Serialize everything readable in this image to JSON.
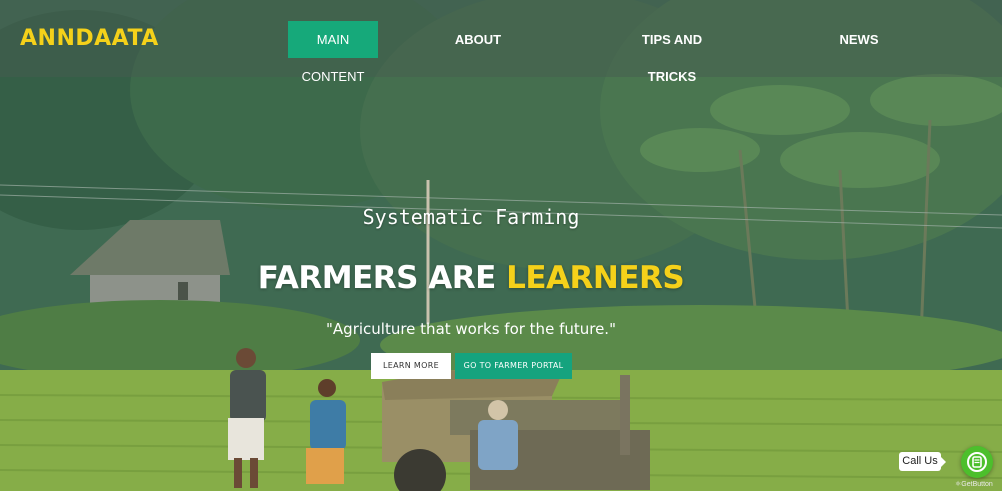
{
  "brand": {
    "name": "ANNDAATA"
  },
  "nav": {
    "items": [
      {
        "label": "MAIN CONTENT",
        "active": true
      },
      {
        "label": "ABOUT",
        "active": false
      },
      {
        "label": "TIPS AND TRICKS",
        "active": false
      },
      {
        "label": "NEWS",
        "active": false
      }
    ]
  },
  "hero": {
    "subtitle": "Systematic Farming",
    "headline_part1": "FARMERS ARE",
    "headline_part2": "LEARNERS",
    "quote": "\"Agriculture that works for the future.\"",
    "buttons": {
      "learn_more": "LEARN MORE",
      "farmer_portal": "GO TO FARMER PORTAL"
    }
  },
  "widget": {
    "call_label": "Call Us",
    "powered_by": "GetButton",
    "icon": "chat-bubble-icon"
  },
  "colors": {
    "accent_yellow": "#f5d11a",
    "accent_green": "#15a37e",
    "call_green": "#4cbf2c"
  }
}
